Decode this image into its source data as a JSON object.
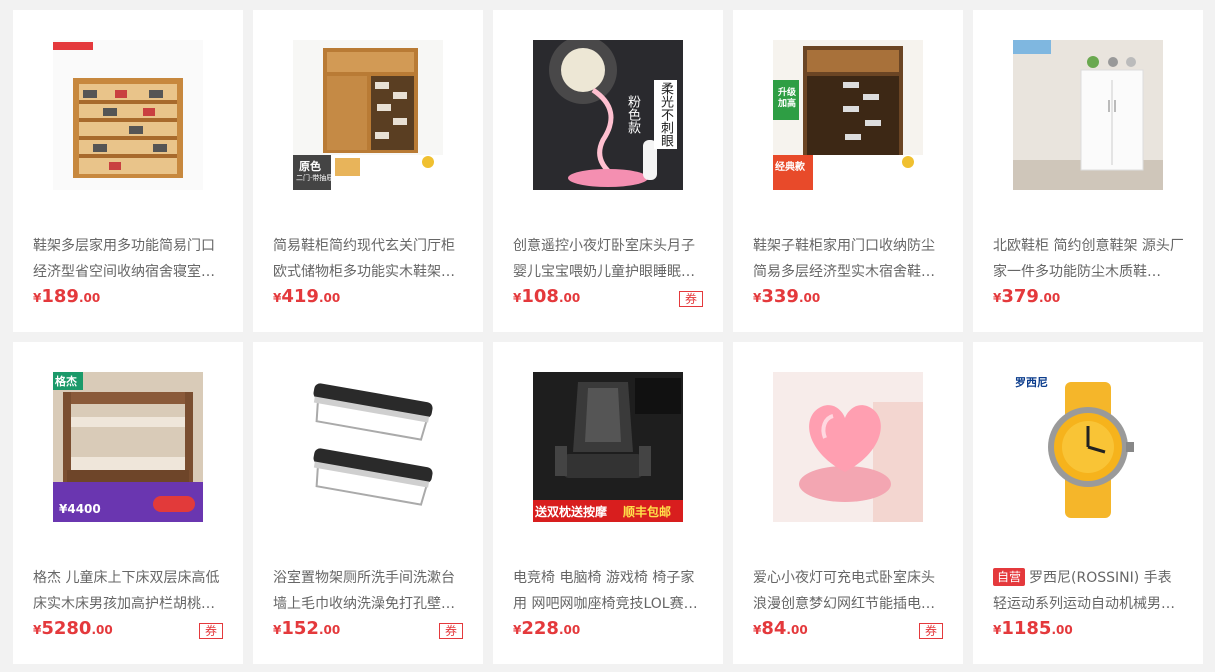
{
  "currency_symbol": "¥",
  "self_tag": "自营",
  "colors": {
    "price_red": "#e4393c",
    "title_gray": "#666666",
    "page_bg": "#f2f2f2"
  },
  "products": [
    {
      "title": "鞋架多层家用多功能简易门口经济型省空间收纳宿舍寝室…",
      "price_int": "189",
      "price_dec": ".00",
      "coupon": "",
      "icon": "shoe-rack-image"
    },
    {
      "title": "简易鞋柜简约现代玄关门厅柜欧式储物柜多功能实木鞋架…",
      "price_int": "419",
      "price_dec": ".00",
      "coupon": "",
      "icon": "shoe-cabinet-image",
      "image_text": [
        "原色",
        "二门·带抽屉"
      ]
    },
    {
      "title": "创意遥控小夜灯卧室床头月子婴儿宝宝喂奶儿童护眼睡眠…",
      "price_int": "108",
      "price_dec": ".00",
      "coupon": "券",
      "icon": "night-lamp-image",
      "image_text": [
        "柔光不刺眼",
        "粉色款"
      ]
    },
    {
      "title": "鞋架子鞋柜家用门口收纳防尘简易多层经济型实木宿舍鞋…",
      "price_int": "339",
      "price_dec": ".00",
      "coupon": "",
      "icon": "shoe-cabinet-image",
      "image_text": [
        "升级加高",
        "经典款"
      ]
    },
    {
      "title": "北欧鞋柜 简约创意鞋架 源头厂家一件多功能防尘木质鞋…",
      "price_int": "379",
      "price_dec": ".00",
      "coupon": "",
      "icon": "white-cabinet-image"
    },
    {
      "title": "格杰 儿童床上下床双层床高低床实木床男孩加高护栏胡桃…",
      "price_int": "5280",
      "price_dec": ".00",
      "coupon": "券",
      "icon": "bunk-bed-image",
      "image_text": [
        "格杰",
        "¥4400"
      ]
    },
    {
      "title": "浴室置物架厕所洗手间洗漱台墙上毛巾收纳洗澡免打孔壁…",
      "price_int": "152",
      "price_dec": ".00",
      "coupon": "券",
      "icon": "bath-shelf-image"
    },
    {
      "title": "电竞椅 电脑椅 游戏椅 椅子家用 网吧网咖座椅竞技LOL赛…",
      "price_int": "228",
      "price_dec": ".00",
      "coupon": "",
      "icon": "gaming-chair-image",
      "image_text": [
        "送双枕送按摩",
        "顺丰包邮"
      ]
    },
    {
      "title": "爱心小夜灯可充电式卧室床头浪漫创意梦幻网红节能插电…",
      "price_int": "84",
      "price_dec": ".00",
      "coupon": "券",
      "icon": "heart-lamp-image"
    },
    {
      "title": "罗西尼(ROSSINI) 手表轻运动系列运动自动机械男…",
      "price_int": "1185",
      "price_dec": ".00",
      "coupon": "",
      "self": true,
      "icon": "watch-image",
      "image_text": [
        "罗西尼"
      ]
    }
  ]
}
